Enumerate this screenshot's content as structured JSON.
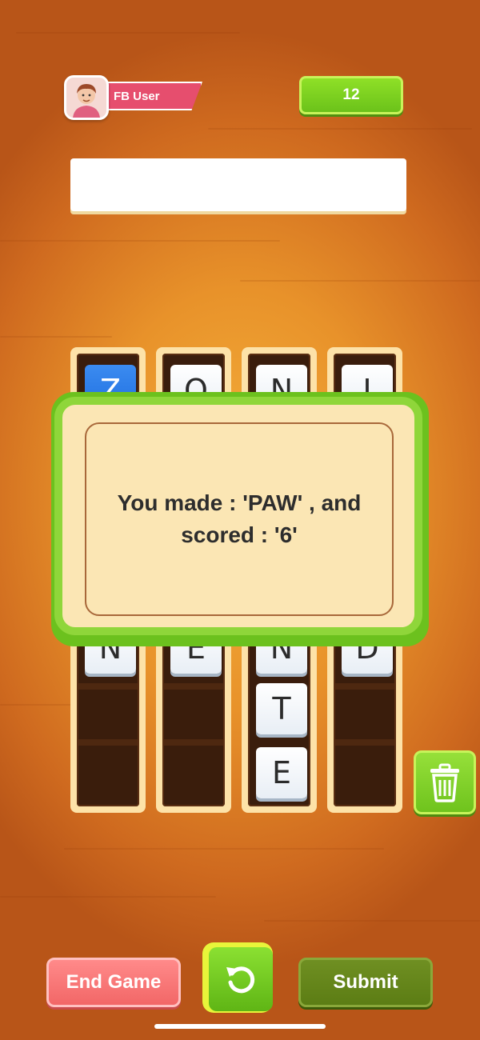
{
  "header": {
    "avatar_icon": "user-avatar-icon",
    "username": "FB User",
    "score": "12"
  },
  "word_bar": {
    "current_word": ""
  },
  "columns": [
    {
      "top": "Z",
      "top_selected": true,
      "bottom": [
        "N"
      ]
    },
    {
      "top": "O",
      "top_selected": false,
      "bottom": [
        "E"
      ]
    },
    {
      "top": "N",
      "top_selected": false,
      "bottom": [
        "N",
        "T",
        "E"
      ]
    },
    {
      "top": "I",
      "top_selected": false,
      "bottom": [
        "D"
      ]
    }
  ],
  "popup": {
    "message": "You made : 'PAW' , and scored : '6'"
  },
  "buttons": {
    "trash_icon": "trash-icon",
    "end_game": "End Game",
    "reset_icon": "refresh-icon",
    "submit": "Submit"
  },
  "colors": {
    "accent_green": "#6fc31d",
    "end_red": "#f26767",
    "submit_olive": "#5c7d14",
    "selected_blue": "#1e6ee0"
  }
}
